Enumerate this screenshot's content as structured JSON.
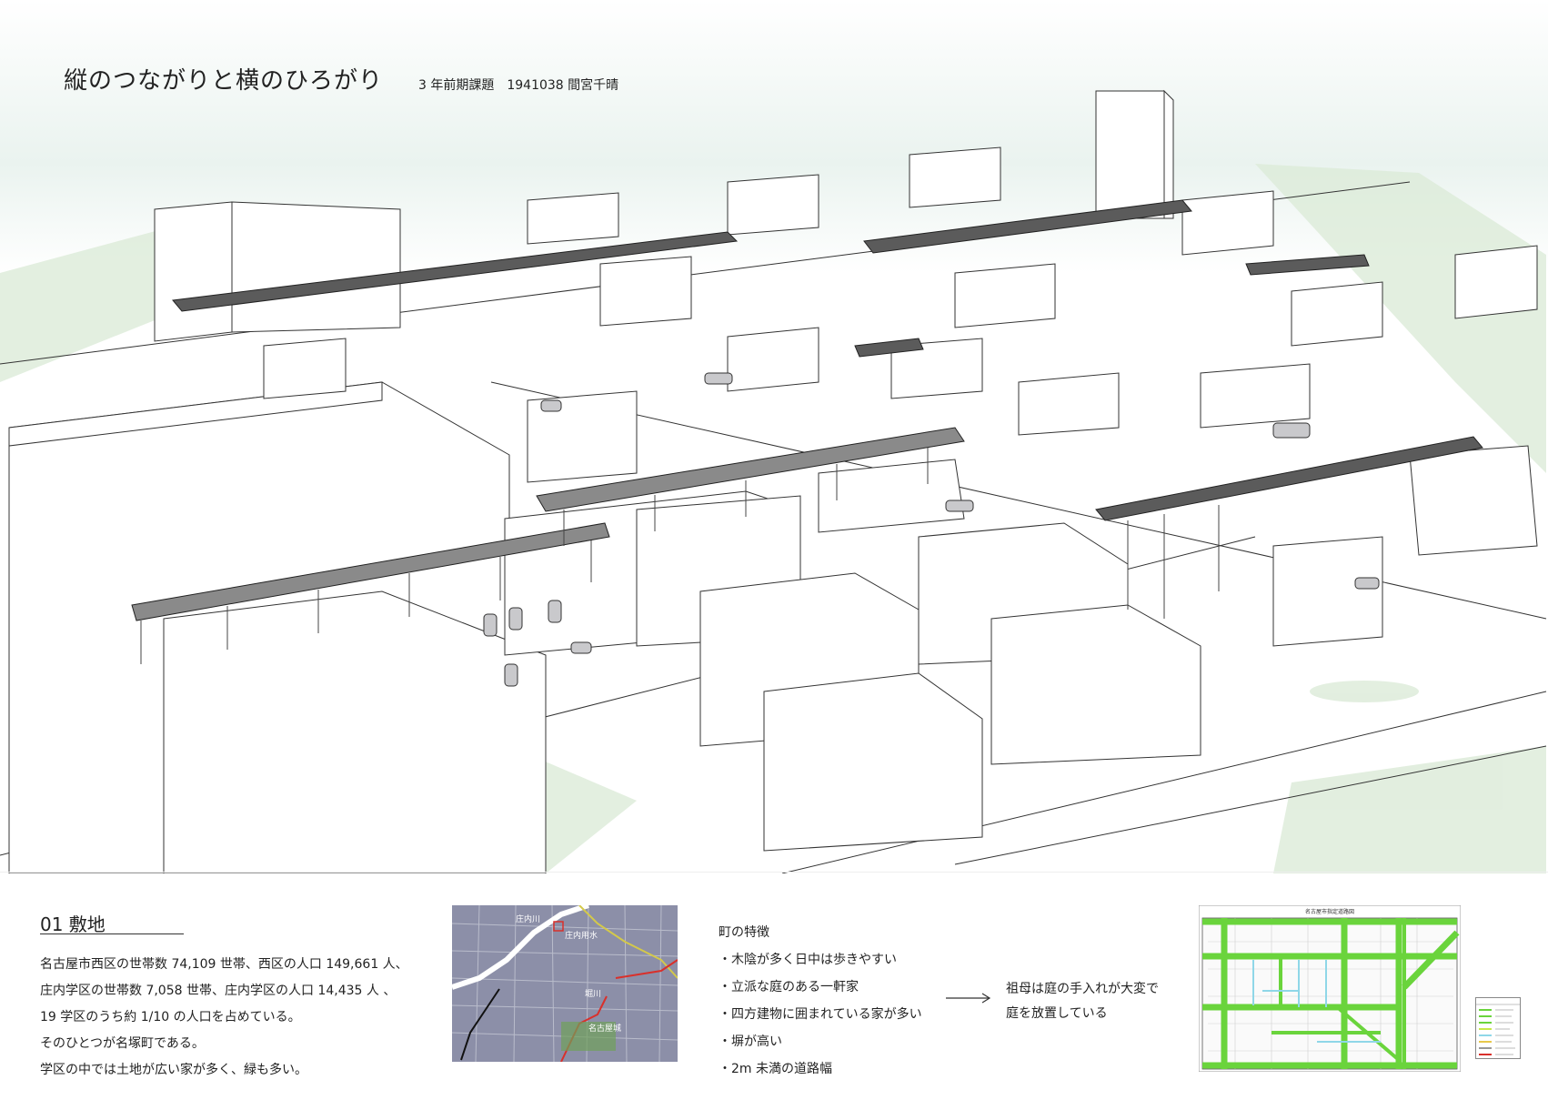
{
  "header": {
    "title": "縦のつながりと横のひろがり",
    "subtitle": "3 年前期課題　1941038 間宮千晴"
  },
  "site": {
    "heading": "01 敷地",
    "description": [
      "名古屋市西区の世帯数 74,109 世帯、西区の人口 149,661 人、",
      "庄内学区の世帯数 7,058 世帯、庄内学区の人口 14,435 人 、",
      "19 学区のうち約 1/10 の人口を占めている。",
      "そのひとつが名塚町である。",
      "学区の中では土地が広い家が多く、緑も多い。"
    ]
  },
  "map": {
    "labels": [
      "庄内川",
      "庄内用水",
      "堀川",
      "名古屋城"
    ],
    "colors": {
      "base": "#8c8fa8",
      "highlight": "#d9302b",
      "water": "#ffffff"
    }
  },
  "features": {
    "title": "町の特徴",
    "items": [
      "木陰が多く日中は歩きやすい",
      "立派な庭のある一軒家",
      "四方建物に囲まれている家が多い",
      "塀が高い",
      "2m 未満の道路幅"
    ]
  },
  "consequence": {
    "lines": [
      "祖母は庭の手入れが大変で",
      "庭を放置している"
    ]
  },
  "road_map": {
    "title": "名古屋市指定道路図",
    "colors": {
      "road": "#6ad43c",
      "secondary": "#8fd7e8"
    }
  }
}
